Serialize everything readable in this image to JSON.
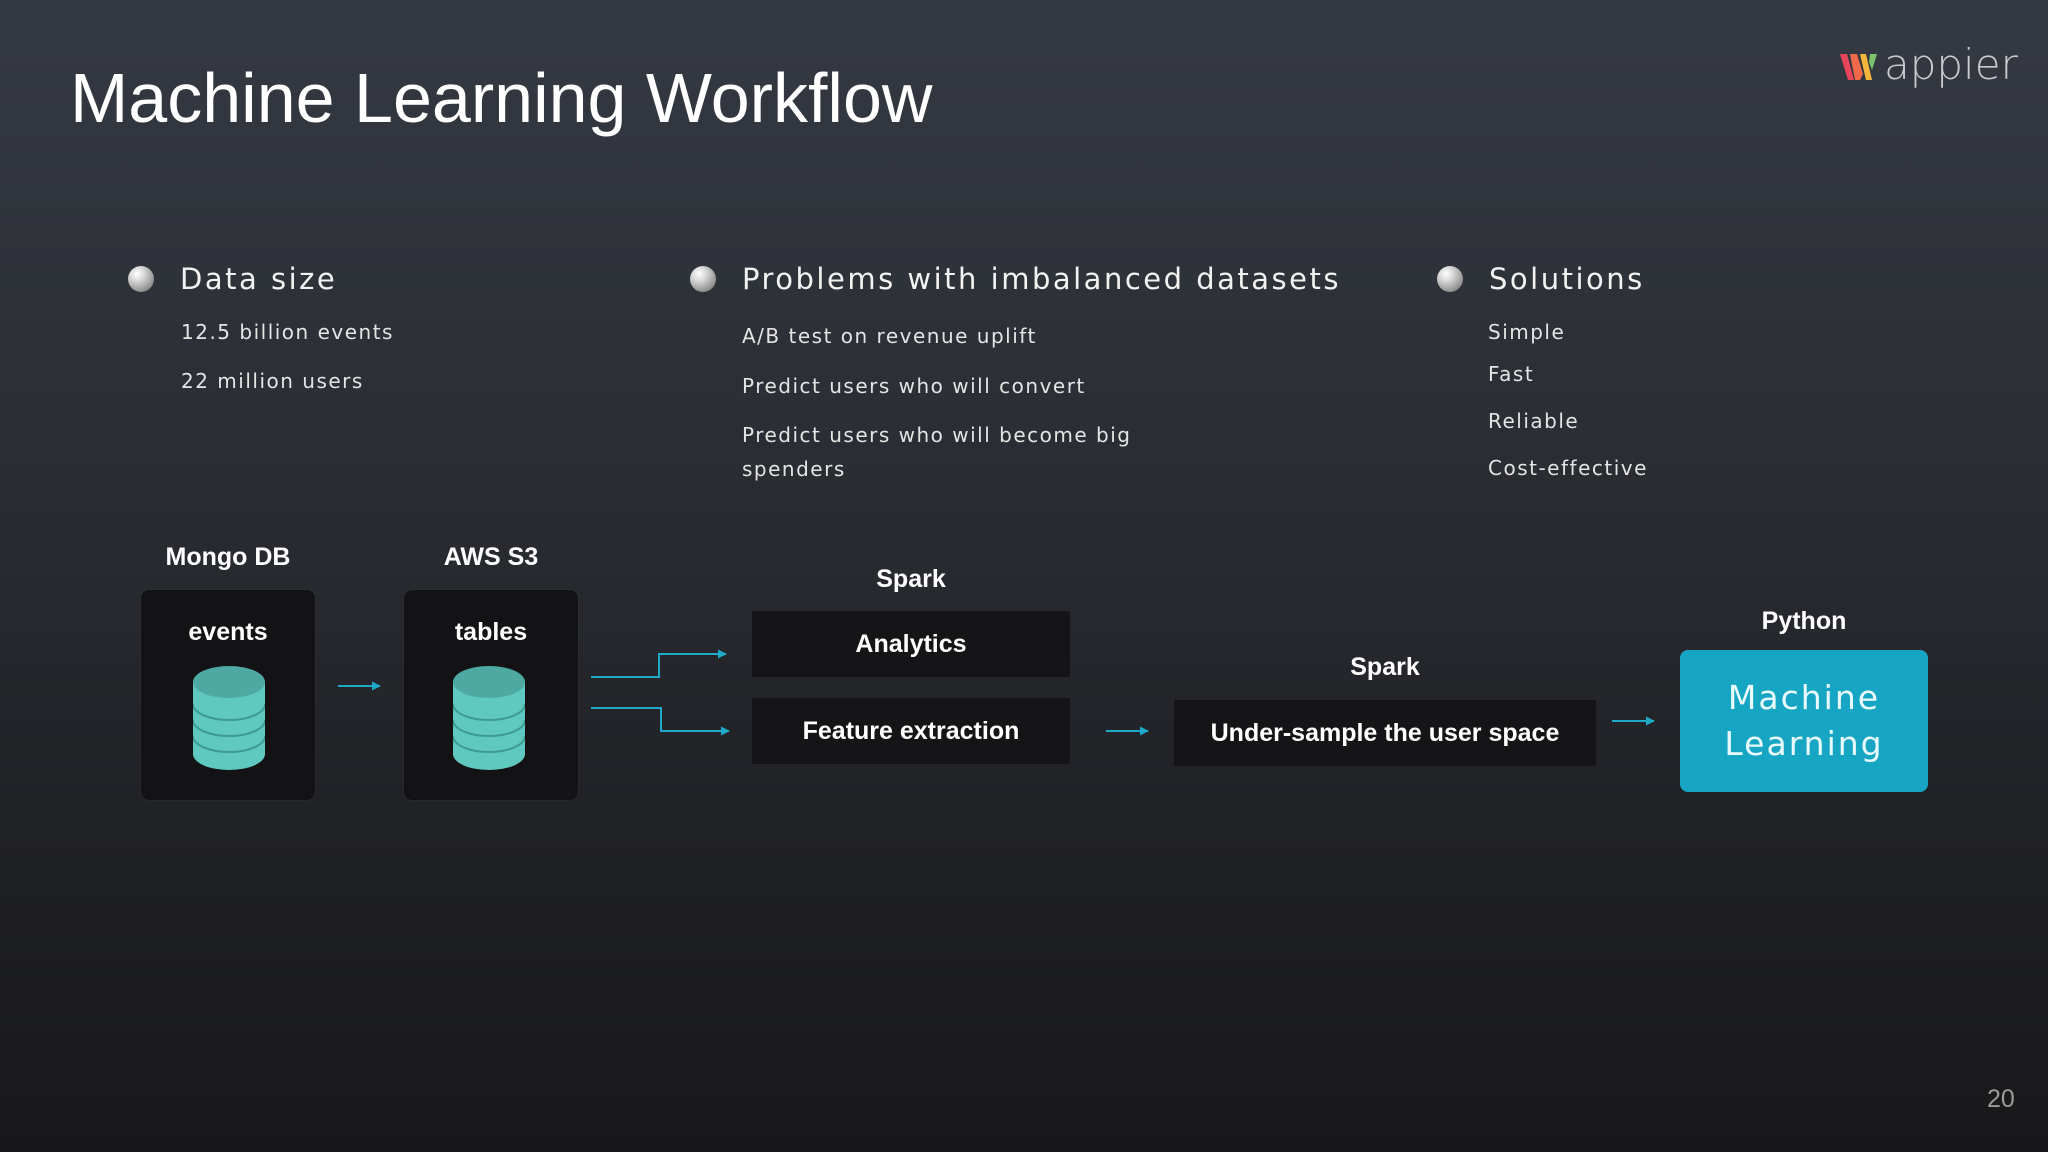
{
  "slide": {
    "title": "Machine Learning Workflow",
    "logo_text": "appier",
    "page_number": "20"
  },
  "columns": [
    {
      "heading": "Data size",
      "items": [
        "12.5 billion events",
        "22 million users"
      ]
    },
    {
      "heading": "Problems with imbalanced datasets",
      "items": [
        "A/B test on revenue uplift",
        "Predict users who will convert",
        "Predict users who will become big",
        "spenders"
      ]
    },
    {
      "heading": "Solutions",
      "items": [
        "Simple",
        "Fast",
        "Reliable",
        "Cost-effective"
      ]
    }
  ],
  "workflow": {
    "mongo": {
      "label": "Mongo DB",
      "box_text": "events"
    },
    "s3": {
      "label": "AWS S3",
      "box_text": "tables"
    },
    "spark1": {
      "label": "Spark",
      "analytics": "Analytics",
      "feature": "Feature extraction"
    },
    "spark2": {
      "label": "Spark",
      "box_text": "Under-sample the user space"
    },
    "python": {
      "label": "Python",
      "line1": "Machine",
      "line2": "Learning"
    }
  },
  "colors": {
    "accent": "#16a6c4",
    "arrow": "#1fa9c9",
    "db_icon": "#5fc9bf",
    "logo_red": "#e8455b",
    "logo_yellow": "#f3b53c"
  }
}
